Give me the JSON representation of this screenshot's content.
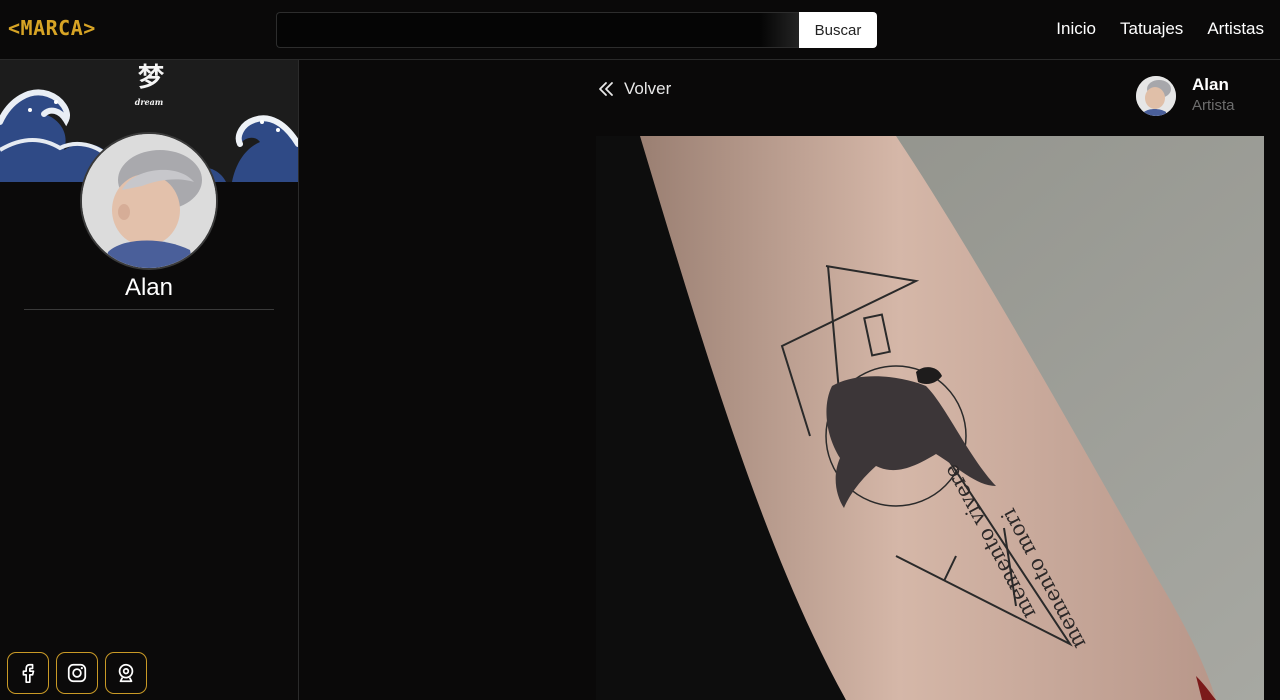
{
  "navbar": {
    "brand": "<MARCA>",
    "search": {
      "value": "",
      "placeholder": ""
    },
    "search_button": "Buscar",
    "links": [
      "Inicio",
      "Tatuajes",
      "Artistas"
    ]
  },
  "sidebar": {
    "banner_kanji": "梦",
    "banner_caption": "dream",
    "artist_name": "Alan",
    "socials": [
      "facebook-icon",
      "instagram-icon",
      "webcam-icon"
    ]
  },
  "main": {
    "back_label": "Volver",
    "author": {
      "name": "Alan",
      "role": "Artista"
    },
    "tattoo_text_1": "memento mori",
    "tattoo_text_2": "memento vivere"
  },
  "colors": {
    "accent": "#d7a425",
    "background": "#0a0909",
    "wave": "#2f4a86"
  }
}
